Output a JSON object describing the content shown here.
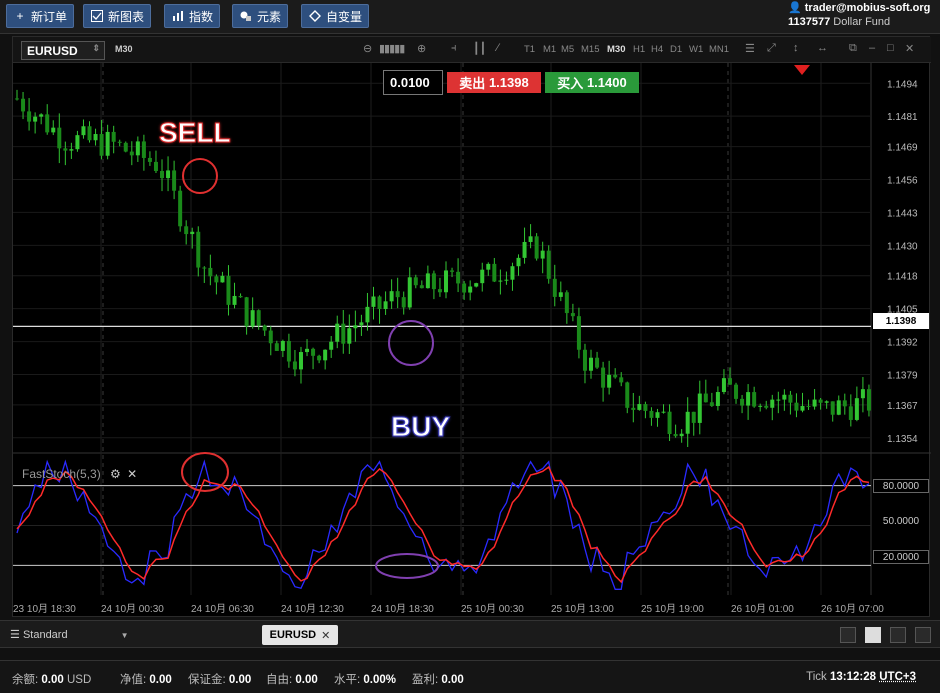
{
  "toolbar": {
    "new_order": "新订单",
    "new_chart": "新图表",
    "indicators": "指数",
    "elements": "元素",
    "variables": "自变量"
  },
  "account": {
    "user": "trader@mobius-soft.org",
    "fund_id": "1137577",
    "fund_name": "Dollar Fund"
  },
  "chart": {
    "symbol": "EURUSD",
    "timeframe_current": "M30",
    "timeframes": [
      "T1",
      "M1",
      "M5",
      "M15",
      "M30",
      "H1",
      "H4",
      "D1",
      "W1",
      "MN1"
    ],
    "active_timeframe": "M30",
    "lot": "0.0100",
    "sell_label": "卖出",
    "sell_price": "1.1398",
    "buy_label": "买入",
    "buy_price": "1.1400",
    "current_price_label": "1.1398",
    "price_axis": [
      "1.1494",
      "1.1481",
      "1.1469",
      "1.1456",
      "1.1443",
      "1.1430",
      "1.1418",
      "1.1405",
      "1.1392",
      "1.1379",
      "1.1367",
      "1.1354"
    ],
    "annotation_sell": "SELL",
    "annotation_buy": "BUY",
    "oscillator_name": "FastStoch(5,3)",
    "osc_levels": [
      "80.0000",
      "50.0000",
      "20.0000"
    ],
    "time_axis": [
      "23 10月 18:30",
      "24 10月 00:30",
      "24 10月 06:30",
      "24 10月 12:30",
      "24 10月 18:30",
      "25 10月 00:30",
      "25 10月 13:00",
      "25 10月 19:00",
      "26 10月 01:00",
      "26 10月 07:00"
    ],
    "colors": {
      "bull": "#33c633",
      "stoch_k": "#2a2aff",
      "stoch_d": "#ff2a2a",
      "sell": "#dd3333",
      "buy": "#2a9a3a"
    }
  },
  "chart_data": {
    "type": "line",
    "title": "EURUSD",
    "xlabel": "",
    "ylabel": "",
    "ylim": [
      1.1348,
      1.1502
    ],
    "x": [
      "23 10月 18:30",
      "24 10月 00:30",
      "24 10月 06:30",
      "24 10月 12:30",
      "24 10月 18:30",
      "25 10月 00:30",
      "25 10月 13:00",
      "25 10月 19:00",
      "26 10月 01:00",
      "26 10月 07:00"
    ],
    "series": [
      {
        "values": [
          1.1488,
          1.1472,
          1.147,
          1.1462,
          1.142,
          1.14,
          1.1385,
          1.1397,
          1.141,
          1.1415,
          1.1418,
          1.143,
          1.1385,
          1.1367,
          1.136,
          1.1373,
          1.137,
          1.1365,
          1.1368
        ]
      }
    ]
  },
  "tabs": {
    "workspace": "Standard",
    "chart_tab": "EURUSD"
  },
  "status": {
    "balance_label": "余额:",
    "balance_value": "0.00",
    "balance_ccy": "USD",
    "equity_label": "净值:",
    "equity_value": "0.00",
    "margin_label": "保证金:",
    "margin_value": "0.00",
    "free_label": "自由:",
    "free_value": "0.00",
    "level_label": "水平:",
    "level_value": "0.00%",
    "pl_label": "盈利:",
    "pl_value": "0.00",
    "tick_label": "Tick",
    "time": "13:12:28",
    "tz": "UTC+3"
  }
}
